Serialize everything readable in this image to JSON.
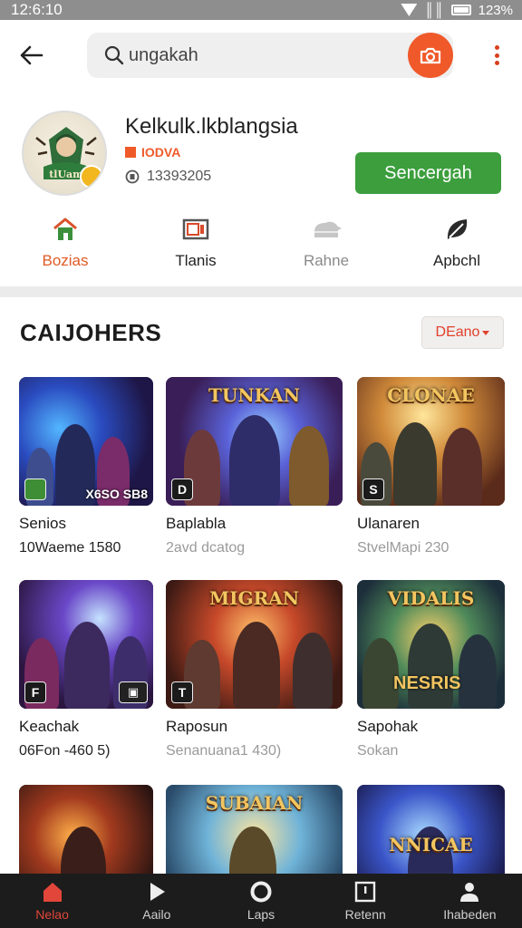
{
  "status_bar": {
    "time": "12:6:10",
    "battery_text": "123%"
  },
  "search": {
    "value": "ungakah"
  },
  "profile": {
    "name": "Kelkulk.lkblangsia",
    "tag": "IODVA",
    "followers": "13393205",
    "subscribe_label": "Sencergah"
  },
  "tabs": [
    {
      "label": "Bozias",
      "icon": "home-icon"
    },
    {
      "label": "Tlanis",
      "icon": "video-icon"
    },
    {
      "label": "Rahne",
      "icon": "cloud-icon"
    },
    {
      "label": "Apbchl",
      "icon": "leaf-icon"
    }
  ],
  "section": {
    "title": "CAIJOHERS",
    "sort_label": "DEano"
  },
  "cards": [
    {
      "title": "Senios",
      "subtitle": "10Waeme 1580",
      "overlay": "",
      "corner_icon": "",
      "corner_text": "X6SO  SB8"
    },
    {
      "title": "Baplabla",
      "subtitle": "2avd dcatog",
      "overlay": "TUNKAN",
      "corner_icon": "D",
      "corner_text": ""
    },
    {
      "title": "Ulanaren",
      "subtitle": "StvelMapi  230",
      "overlay": "CLONAE",
      "corner_icon": "S",
      "corner_text": ""
    },
    {
      "title": "Keachak",
      "subtitle": "06Fon -460 5)",
      "overlay": "",
      "corner_icon": "F",
      "corner_text": ""
    },
    {
      "title": "Raposun",
      "subtitle": "Senanuana1 430)",
      "overlay": "MIGRAN",
      "corner_icon": "T",
      "corner_text": ""
    },
    {
      "title": "Sapohak",
      "subtitle": "Sokan",
      "overlay": "VIDALIS",
      "corner_icon": "",
      "corner_text": "NESRIS"
    },
    {
      "title": "",
      "subtitle": "",
      "overlay": "",
      "corner_icon": "",
      "corner_text": ""
    },
    {
      "title": "",
      "subtitle": "",
      "overlay": "SUBAIAN",
      "corner_icon": "",
      "corner_text": ""
    },
    {
      "title": "",
      "subtitle": "",
      "overlay": "NNICAE",
      "corner_icon": "",
      "corner_text": ""
    }
  ],
  "bottom_nav": [
    {
      "label": "Nelao",
      "icon": "home-icon"
    },
    {
      "label": "Aailo",
      "icon": "play-icon"
    },
    {
      "label": "Laps",
      "icon": "circle-icon"
    },
    {
      "label": "Retenn",
      "icon": "box-icon"
    },
    {
      "label": "Ihabeden",
      "icon": "user-icon"
    }
  ],
  "colors": {
    "accent": "#e05a24",
    "green": "#3c9e3d",
    "nav_bg": "#1c1c1c"
  }
}
